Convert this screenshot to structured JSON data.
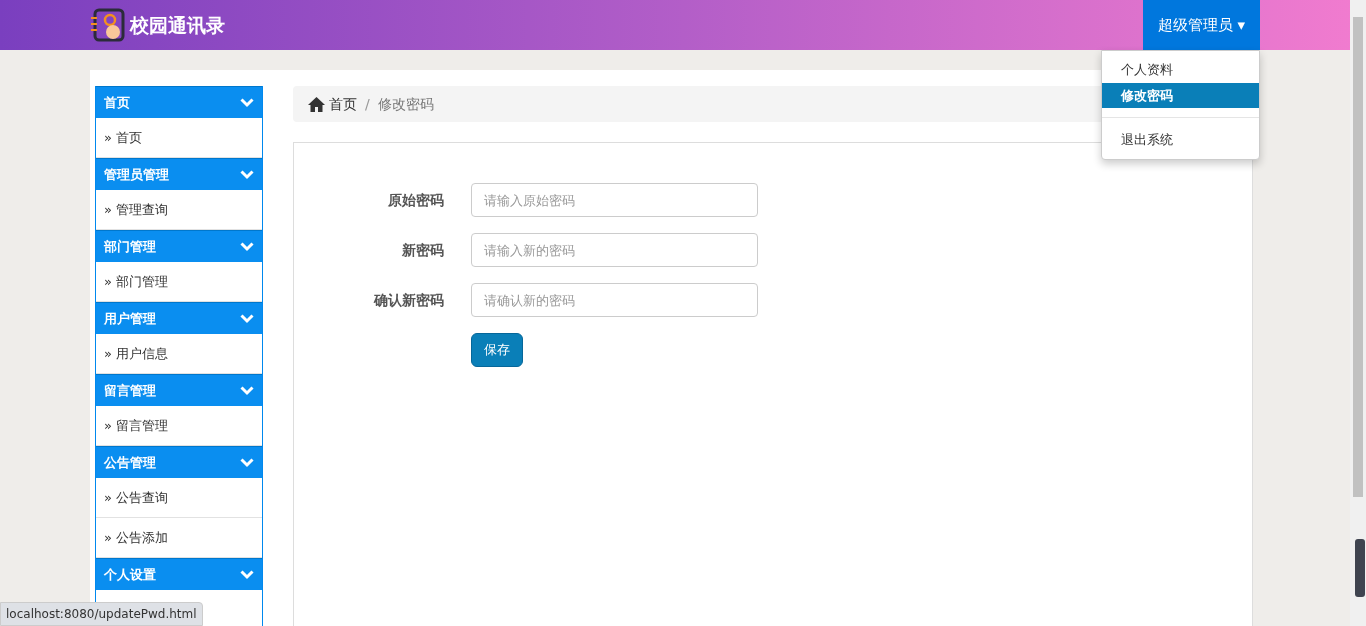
{
  "navbar": {
    "brand": "校园通讯录",
    "user_menu": {
      "label": "超级管理员",
      "caret": "▾",
      "expanded": true,
      "items": [
        {
          "kind": "link",
          "label": "个人资料",
          "selected": false
        },
        {
          "kind": "link",
          "label": "修改密码",
          "selected": true
        },
        {
          "kind": "divider"
        },
        {
          "kind": "link",
          "label": "退出系统",
          "selected": false
        }
      ]
    }
  },
  "sidebar": {
    "groups": [
      {
        "title": "首页",
        "expanded": true,
        "items": [
          {
            "label": "首页",
            "marker": "»"
          }
        ]
      },
      {
        "title": "管理员管理",
        "expanded": true,
        "items": [
          {
            "label": "管理查询",
            "marker": "»"
          }
        ]
      },
      {
        "title": "部门管理",
        "expanded": true,
        "items": [
          {
            "label": "部门管理",
            "marker": "»"
          }
        ]
      },
      {
        "title": "用户管理",
        "expanded": true,
        "items": [
          {
            "label": "用户信息",
            "marker": "»"
          }
        ]
      },
      {
        "title": "留言管理",
        "expanded": true,
        "items": [
          {
            "label": "留言管理",
            "marker": "»"
          }
        ]
      },
      {
        "title": "公告管理",
        "expanded": true,
        "items": [
          {
            "label": "公告查询",
            "marker": "»"
          },
          {
            "label": "公告添加",
            "marker": "»"
          }
        ]
      },
      {
        "title": "个人设置",
        "expanded": true
      }
    ]
  },
  "breadcrumb": [
    {
      "label": "首页",
      "kind": "home"
    },
    {
      "label": "修改密码",
      "kind": "current",
      "separator": "/"
    }
  ],
  "form": {
    "fields": [
      {
        "label": "原始密码",
        "placeholder": "请输入原始密码"
      },
      {
        "label": "新密码",
        "placeholder": "请输入新的密码"
      },
      {
        "label": "确认新密码",
        "placeholder": "请确认新的密码"
      }
    ],
    "submit": "保存"
  },
  "status_bar": {
    "url": "localhost:8080/updatePwd.html"
  }
}
